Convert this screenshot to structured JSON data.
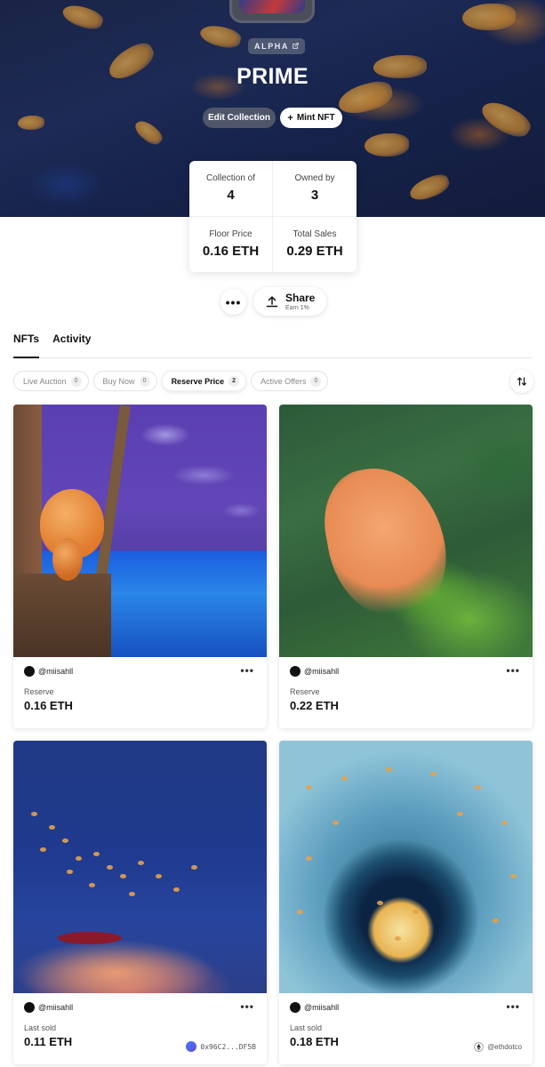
{
  "collection": {
    "badge": "ALPHA",
    "title": "PRIME",
    "edit_button": "Edit Collection",
    "mint_button": "Mint NFT"
  },
  "stats": [
    {
      "label": "Collection of",
      "value": "4"
    },
    {
      "label": "Owned by",
      "value": "3"
    },
    {
      "label": "Floor Price",
      "value": "0.16 ETH"
    },
    {
      "label": "Total Sales",
      "value": "0.29 ETH"
    }
  ],
  "share": {
    "label": "Share",
    "sub": "Earn 1%"
  },
  "tabs": [
    {
      "label": "NFTs",
      "active": true
    },
    {
      "label": "Activity",
      "active": false
    }
  ],
  "filters": [
    {
      "label": "Live Auction",
      "count": "0",
      "active": false
    },
    {
      "label": "Buy Now",
      "count": "0",
      "active": false
    },
    {
      "label": "Reserve Price",
      "count": "2",
      "active": true
    },
    {
      "label": "Active Offers",
      "count": "0",
      "active": false
    }
  ],
  "nfts": [
    {
      "creator": "@miisahll",
      "price_label": "Reserve",
      "price": "0.16 ETH",
      "owner": ""
    },
    {
      "creator": "@miisahll",
      "price_label": "Reserve",
      "price": "0.22 ETH",
      "owner": ""
    },
    {
      "creator": "@miisahll",
      "price_label": "Last sold",
      "price": "0.11 ETH",
      "owner": "0x96C2...DF5B"
    },
    {
      "creator": "@miisahll",
      "price_label": "Last sold",
      "price": "0.18 ETH",
      "owner": "@ethdotco"
    }
  ],
  "icons": {
    "more": "more-horizontal-icon",
    "share": "share-upload-icon",
    "sort": "sort-arrows-icon",
    "external": "external-link-icon",
    "plus": "plus-icon"
  }
}
